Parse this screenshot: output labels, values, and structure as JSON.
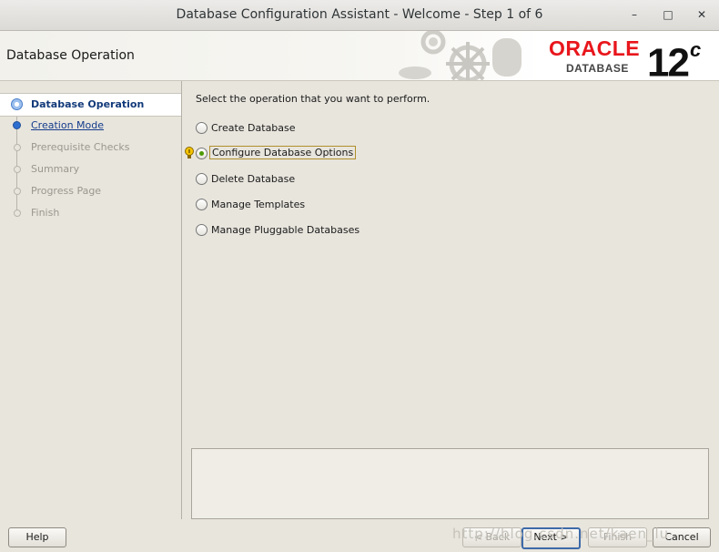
{
  "window": {
    "title": "Database Configuration Assistant - Welcome - Step 1 of 6",
    "minimize_glyph": "–",
    "maximize_glyph": "□",
    "close_glyph": "✕"
  },
  "header": {
    "title": "Database Operation",
    "brand": "ORACLE",
    "product": "DATABASE",
    "version": "12",
    "version_suffix": "c"
  },
  "steps": [
    {
      "label": "Database Operation",
      "state": "current"
    },
    {
      "label": "Creation Mode",
      "state": "link"
    },
    {
      "label": "Prerequisite Checks",
      "state": "disabled"
    },
    {
      "label": "Summary",
      "state": "disabled"
    },
    {
      "label": "Progress Page",
      "state": "disabled"
    },
    {
      "label": "Finish",
      "state": "disabled"
    }
  ],
  "content": {
    "instruction": "Select the operation that you want to perform.",
    "options": [
      {
        "label": "Create Database",
        "selected": false
      },
      {
        "label": "Configure Database Options",
        "selected": true
      },
      {
        "label": "Delete Database",
        "selected": false
      },
      {
        "label": "Manage Templates",
        "selected": false
      },
      {
        "label": "Manage Pluggable Databases",
        "selected": false
      }
    ],
    "hint_icon": "lightbulb-icon"
  },
  "footer": {
    "help": "Help",
    "back": "< Back",
    "next": "Next >",
    "finish": "Finish",
    "cancel": "Cancel"
  },
  "watermark": "http://blog.csdn.net/kaen_lu",
  "colors": {
    "oracle_red": "#e8161c",
    "current_step": "#123a7a",
    "link": "#143c8c",
    "radio_selected": "#4e9a06"
  }
}
